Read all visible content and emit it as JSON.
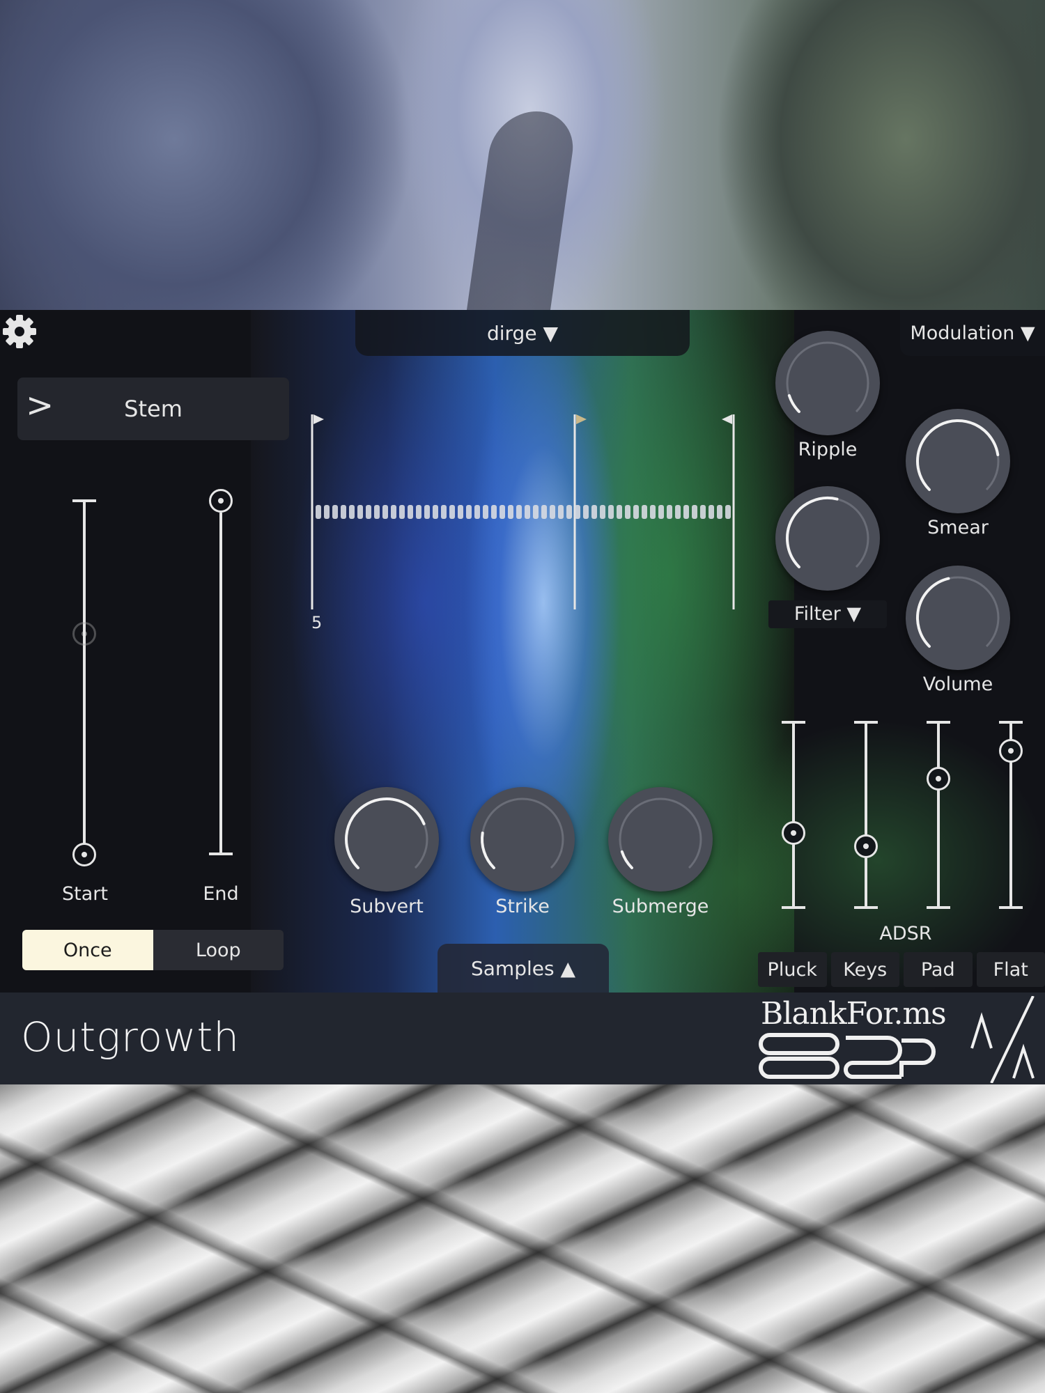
{
  "app": {
    "title": "Outgrowth",
    "brand": "BlankFor.ms"
  },
  "header": {
    "preset_label": "dirge ▼",
    "modulation_label": "Modulation ▼"
  },
  "left_panel": {
    "stem_chevron": ">",
    "stem_label": "Stem",
    "start_label": "Start",
    "end_label": "End",
    "mode_options": [
      "Once",
      "Loop"
    ],
    "mode_selected": "Once"
  },
  "waveform": {
    "marker_number": "5"
  },
  "knobs": {
    "ripple": {
      "label": "Ripple",
      "value": 0.1
    },
    "smear": {
      "label": "Smear",
      "value": 0.8
    },
    "filter": {
      "label": "Filter ▼",
      "value": 0.55
    },
    "volume": {
      "label": "Volume",
      "value": 0.45
    },
    "subvert": {
      "label": "Subvert",
      "value": 0.75
    },
    "strike": {
      "label": "Strike",
      "value": 0.2
    },
    "submerge": {
      "label": "Submerge",
      "value": 0.1
    }
  },
  "samples": {
    "label": "Samples ▲"
  },
  "adsr": {
    "label": "ADSR",
    "levels": [
      0.4,
      0.33,
      0.7,
      0.85
    ],
    "presets": [
      "Pluck",
      "Keys",
      "Pad",
      "Flat"
    ]
  },
  "colors": {
    "panel": "#111217",
    "foreground": "#e6e6e6",
    "knob": "#4a4d57",
    "selected_segment": "#fbf6df",
    "footer": "#22262f"
  }
}
